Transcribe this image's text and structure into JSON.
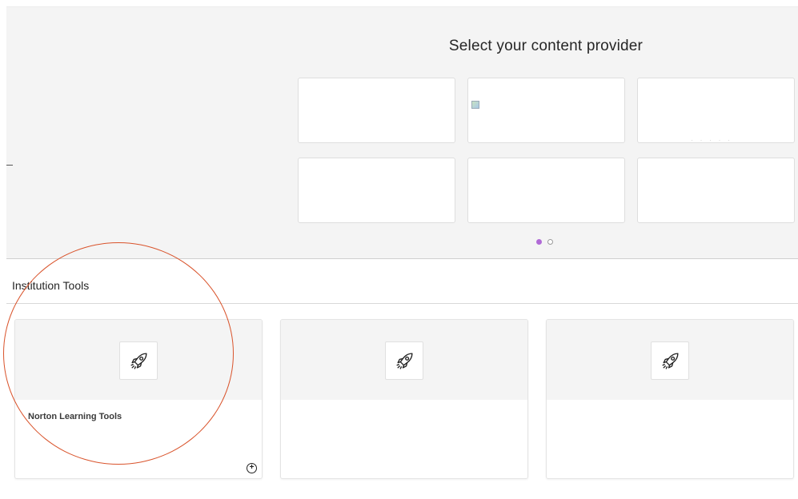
{
  "provider_section": {
    "title": "Select your content provider",
    "tiles": [
      {
        "label": ""
      },
      {
        "label": "",
        "broken_image": true
      },
      {
        "label": "",
        "faint_text": "· · · · ·"
      },
      {
        "label": ""
      },
      {
        "label": ""
      },
      {
        "label": ""
      }
    ],
    "pager": {
      "current_page": 1,
      "total_pages": 2,
      "active_color": "#b06ad6"
    }
  },
  "institution_tools": {
    "header": "Institution Tools",
    "cards": [
      {
        "title": "Norton Learning Tools",
        "icon": "rocket-icon",
        "info_icon": "info-circle-icon"
      },
      {
        "title": "",
        "icon": "rocket-icon"
      },
      {
        "title": "",
        "icon": "rocket-icon"
      }
    ]
  },
  "annotation": {
    "shape": "circle",
    "color": "#d9532b",
    "target": "Norton Learning Tools"
  }
}
